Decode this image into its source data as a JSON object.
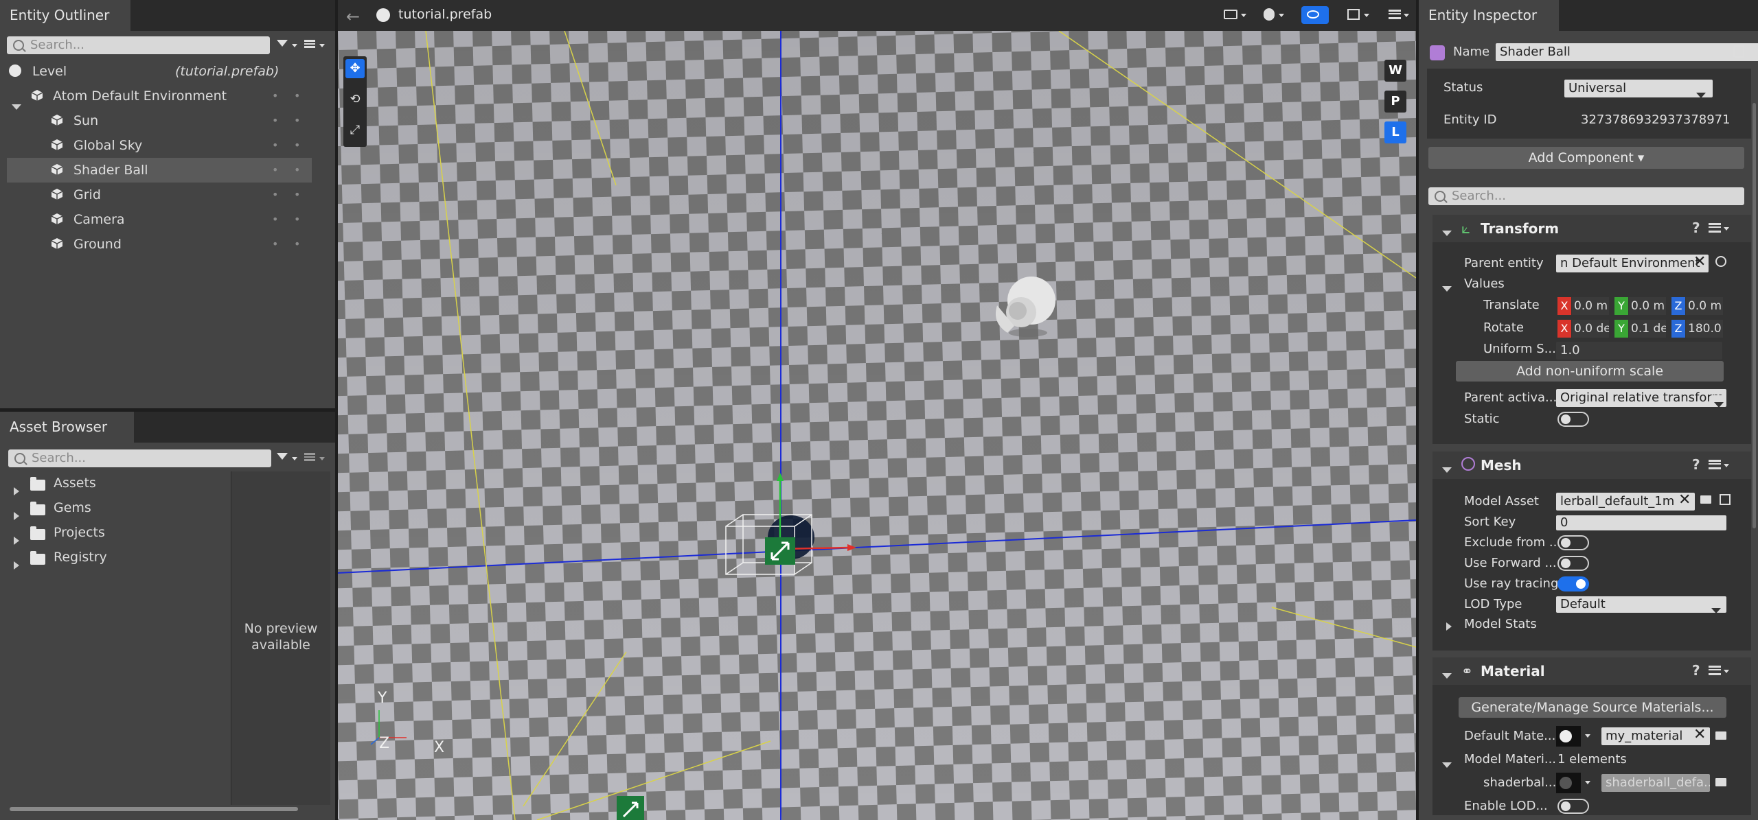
{
  "outliner": {
    "tab_title": "Entity Outliner",
    "search_placeholder": "Search...",
    "level_label": "Level",
    "level_file": "(tutorial.prefab)",
    "root": "Atom Default Environment",
    "children": [
      "Sun",
      "Global Sky",
      "Shader Ball",
      "Grid",
      "Camera",
      "Ground"
    ],
    "selected": "Shader Ball"
  },
  "asset_browser": {
    "tab_title": "Asset Browser",
    "search_placeholder": "Search...",
    "folders": [
      "Assets",
      "Gems",
      "Projects",
      "Registry"
    ],
    "preview_line1": "No preview",
    "preview_line2": "available"
  },
  "viewport": {
    "file_title": "tutorial.prefab",
    "view_modes": [
      "W",
      "P",
      "L"
    ],
    "active_mode": "L",
    "axis_labels": {
      "y": "Y",
      "z": "Z",
      "x": "X"
    }
  },
  "inspector": {
    "tab_title": "Entity Inspector",
    "name_label": "Name",
    "name_value": "Shader Ball",
    "status_label": "Status",
    "status_value": "Universal",
    "entity_id_label": "Entity ID",
    "entity_id_value": "3273786932937378971",
    "add_component": "Add Component ▾",
    "search_placeholder": "Search...",
    "transform": {
      "title": "Transform",
      "parent_entity_label": "Parent entity",
      "parent_entity_value": "n Default Environment",
      "values_label": "Values",
      "translate_label": "Translate",
      "translate": {
        "x": "0.0 m",
        "y": "0.0 m",
        "z": "0.0 m"
      },
      "rotate_label": "Rotate",
      "rotate": {
        "x": "0.0 de",
        "y": "0.1 de",
        "z": "180.0"
      },
      "uniform_label": "Uniform S...",
      "uniform_value": "1.0",
      "nonuniform_button": "Add non-uniform scale",
      "parent_activation_label": "Parent activa...",
      "parent_activation_value": "Original relative transform",
      "static_label": "Static"
    },
    "mesh": {
      "title": "Mesh",
      "model_asset_label": "Model Asset",
      "model_asset_value": "lerball_default_1m",
      "sort_key_label": "Sort Key",
      "sort_key_value": "0",
      "exclude_label": "Exclude from ...",
      "forward_label": "Use Forward ...",
      "raytracing_label": "Use ray tracing",
      "lod_type_label": "LOD Type",
      "lod_type_value": "Default",
      "model_stats_label": "Model Stats"
    },
    "material": {
      "title": "Material",
      "generate_button": "Generate/Manage Source Materials...",
      "default_material_label": "Default Mate...",
      "default_material_value": "my_material",
      "model_materials_label": "Model Materi...",
      "model_materials_count": "1 elements",
      "slot_label": "shaderbal...",
      "slot_value": "shaderball_defa...",
      "enable_lod_label": "Enable LOD..."
    }
  },
  "colors": {
    "accent_blue": "#1e70eb",
    "axis_x": "#d9342b",
    "axis_y": "#3aa635",
    "axis_z": "#2a6ad9",
    "gizmo_green": "#1c7a3a"
  }
}
